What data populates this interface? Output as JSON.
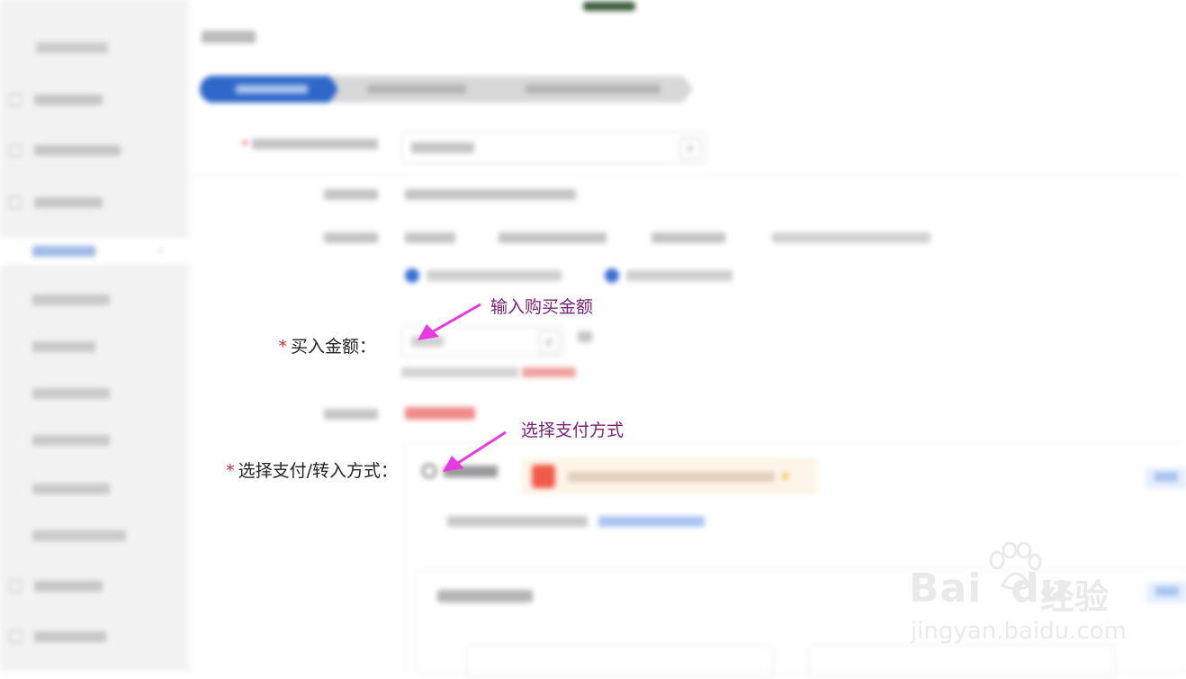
{
  "annotations": {
    "input_amount": "输入购买金额",
    "select_payment": "选择支付方式"
  },
  "form": {
    "required_mark": "*",
    "amount_label": "买入金额：",
    "payment_label": "选择支付/转入方式："
  },
  "watermark": {
    "brand": "Bai",
    "brand_tail": "du",
    "cn": "经验",
    "url": "jingyan.baidu.com"
  },
  "colors": {
    "accent": "#2f68c8",
    "annotation_arrow": "#e83ae0",
    "annotation_text": "#7a1f78",
    "required": "#d6223b"
  },
  "icons": {
    "arrow_amount": "magenta-arrow-icon",
    "arrow_payment": "magenta-arrow-icon",
    "watermark_paw": "paw-icon"
  }
}
